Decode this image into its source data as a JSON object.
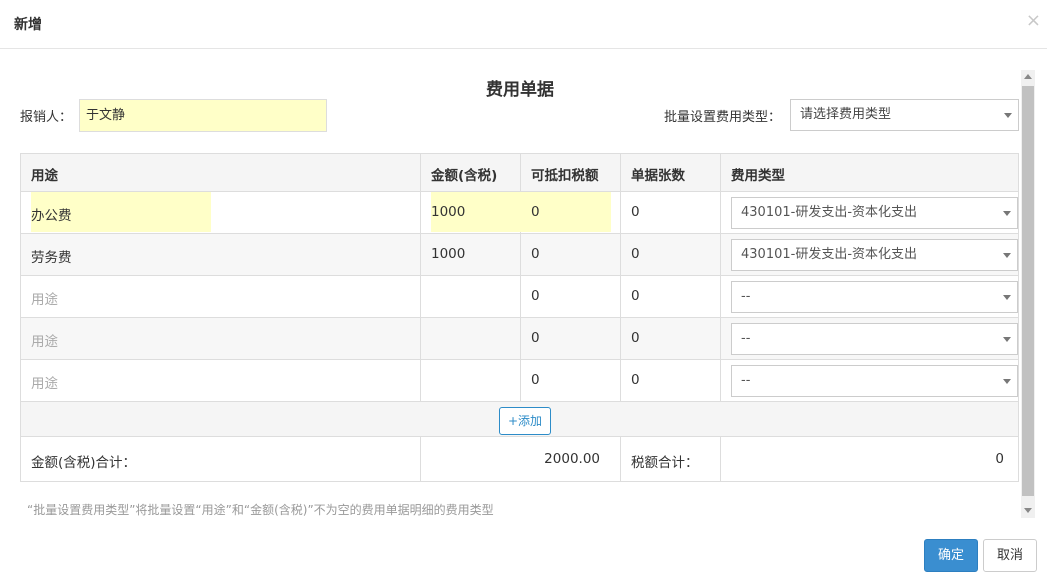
{
  "dialog": {
    "title": "新增",
    "close_icon": "×"
  },
  "form": {
    "title": "费用单据",
    "reimburser_label": "报销人：",
    "reimburser_value": "于文静",
    "batch_type_label": "批量设置费用类型：",
    "batch_type_value": "请选择费用类型"
  },
  "table": {
    "headers": [
      "用途",
      "金额(含税)",
      "可抵扣税额",
      "单据张数",
      "费用类型"
    ],
    "rows": [
      {
        "purpose": "办公费",
        "purpose_placeholder": false,
        "amount": "1000",
        "deductible": "0",
        "count": "0",
        "type": "430101-研发支出-资本化支出"
      },
      {
        "purpose": "劳务费",
        "purpose_placeholder": false,
        "amount": "1000",
        "deductible": "0",
        "count": "0",
        "type": "430101-研发支出-资本化支出"
      },
      {
        "purpose": "用途",
        "purpose_placeholder": true,
        "amount": "",
        "deductible": "0",
        "count": "0",
        "type": "--"
      },
      {
        "purpose": "用途",
        "purpose_placeholder": true,
        "amount": "",
        "deductible": "0",
        "count": "0",
        "type": "--"
      },
      {
        "purpose": "用途",
        "purpose_placeholder": true,
        "amount": "",
        "deductible": "0",
        "count": "0",
        "type": "--"
      }
    ],
    "add_label": "+添加",
    "total_amount_label": "金额(含税)合计：",
    "total_amount_value": "2000.00",
    "total_tax_label": "税额合计：",
    "total_tax_value": "0"
  },
  "note": "“批量设置费用类型”将批量设置“用途”和“金额(含税)”不为空的费用单据明细的费用类型",
  "buttons": {
    "confirm": "确定",
    "cancel": "取消"
  },
  "colors": {
    "highlight": "#ffffc8",
    "primary": "#3a8ed0",
    "link": "#2d8cc8"
  }
}
